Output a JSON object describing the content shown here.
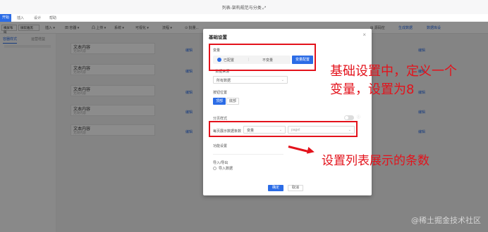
{
  "window": {
    "title": "列表-架构规范与分类 ⤢"
  },
  "menu": {
    "start": "开始",
    "items": [
      "插入",
      "设计",
      "帮助"
    ]
  },
  "toolbar": {
    "page_style": "横屏布局",
    "font": "微软雅黑",
    "insert": "插入 ▾",
    "items": [
      "田 容器 ▾",
      "凸 上传 ▾",
      "系统 ▾",
      "可视化 ▾",
      "流程 ▾",
      "⊙ 批量..."
    ],
    "right_items": [
      "⊞ 源码控",
      "生成数据",
      "数据库设"
    ]
  },
  "sidebar": {
    "tabs": [
      "容器样式",
      "运营增益"
    ]
  },
  "list": {
    "rows": [
      {
        "title": "文本内容",
        "sub": "无效内容",
        "link": "编辑",
        "link2": "编辑"
      },
      {
        "title": "文本内容",
        "sub": "无效内容",
        "link": "编辑",
        "link2": "编辑"
      },
      {
        "title": "文本内容",
        "sub": "无效内容",
        "link": "编辑",
        "link2": "编辑"
      },
      {
        "title": "文本内容",
        "sub": "无效内容",
        "link": "编辑",
        "link2": "编辑"
      },
      {
        "title": "文本内容",
        "sub": "无效内容",
        "link": "编辑",
        "link2": "编辑"
      }
    ]
  },
  "dialog": {
    "title": "基础设置",
    "close": "×",
    "variable_label": "变量",
    "seg_selected": "已配置",
    "seg_sep": "|",
    "seg_other": "不变量",
    "configure_button": "变量配置",
    "data_source_label": "* 数据来源",
    "data_source_value": "所有数据",
    "button_pos_label": "按钮位置",
    "pos_top": "顶部",
    "pos_bottom": "底部",
    "pagination_label": "分页样式",
    "page_size_label": "每页展示数据条数",
    "page_size_value": "变量",
    "page_size_placeholder": "pageI",
    "func_label": "功能设置",
    "import_label": "导入/导出",
    "import_option": "导入数据",
    "ok": "确定",
    "cancel": "取消"
  },
  "annotations": {
    "note1_line1": "基础设置中，定义一个",
    "note1_line2": "变量，设置为8",
    "note2": "设置列表展示的条数"
  },
  "watermark": "@稀土掘金技术社区",
  "colors": {
    "primary": "#2b6ce6",
    "annotation": "#e3121b"
  }
}
